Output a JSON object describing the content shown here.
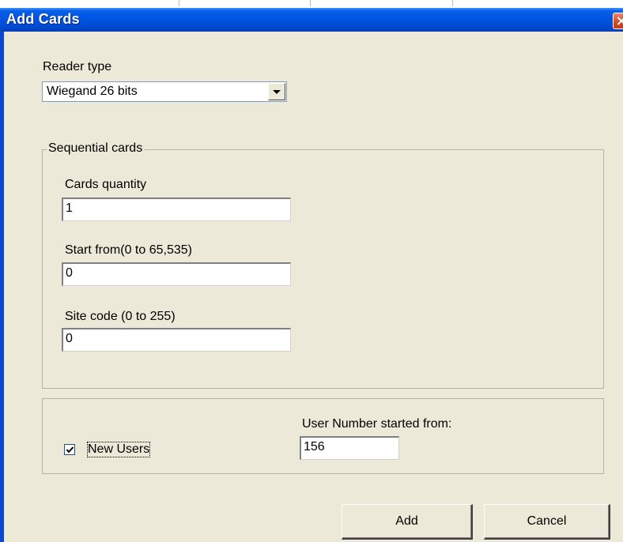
{
  "window": {
    "title": "Add Cards",
    "close_icon": "close-icon"
  },
  "reader": {
    "label": "Reader type",
    "selected": "Wiegand 26 bits",
    "dropdown_icon": "chevron-down-icon"
  },
  "sequential": {
    "legend": "Sequential cards",
    "quantity_label": "Cards quantity",
    "quantity_value": "1",
    "start_label": "Start from(0 to 65,535)",
    "start_value": "0",
    "site_label": "Site code (0 to 255)",
    "site_value": "0"
  },
  "users": {
    "new_users_label": "New Users",
    "new_users_checked": true,
    "user_number_label": "User Number started from:",
    "user_number_value": "156"
  },
  "buttons": {
    "add": "Add",
    "cancel": "Cancel"
  },
  "colors": {
    "titlebar": "#0054e3",
    "dialog_bg": "#ece9d8",
    "close": "#d24b28"
  }
}
